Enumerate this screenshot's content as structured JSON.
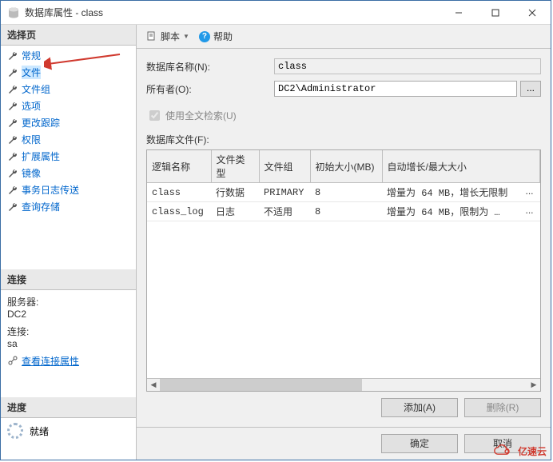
{
  "window": {
    "title": "数据库属性 - class"
  },
  "sidebar": {
    "select_page_header": "选择页",
    "items": [
      {
        "label": "常规"
      },
      {
        "label": "文件"
      },
      {
        "label": "文件组"
      },
      {
        "label": "选项"
      },
      {
        "label": "更改跟踪"
      },
      {
        "label": "权限"
      },
      {
        "label": "扩展属性"
      },
      {
        "label": "镜像"
      },
      {
        "label": "事务日志传送"
      },
      {
        "label": "查询存储"
      }
    ],
    "connection_header": "连接",
    "server_label": "服务器:",
    "server_value": "DC2",
    "conn_label": "连接:",
    "conn_value": "sa",
    "view_props_link": "查看连接属性",
    "progress_header": "进度",
    "ready_label": "就绪"
  },
  "toolbar": {
    "script_label": "脚本",
    "help_label": "帮助"
  },
  "form": {
    "db_name_label": "数据库名称(N):",
    "db_name_value": "class",
    "owner_label": "所有者(O):",
    "owner_value": "DC2\\Administrator",
    "browse_label": "...",
    "fulltext_label": "使用全文检索(U)",
    "files_label": "数据库文件(F):"
  },
  "grid": {
    "headers": {
      "logical_name": "逻辑名称",
      "file_type": "文件类型",
      "filegroup": "文件组",
      "initial_size": "初始大小(MB)",
      "autogrowth": "自动增长/最大大小"
    },
    "rows": [
      {
        "logical_name": "class",
        "file_type": "行数据",
        "filegroup": "PRIMARY",
        "initial_size": "8",
        "autogrowth": "增量为 64 MB，增长无限制",
        "browse": "..."
      },
      {
        "logical_name": "class_log",
        "file_type": "日志",
        "filegroup": "不适用",
        "initial_size": "8",
        "autogrowth": "增量为 64 MB，限制为 …",
        "browse": "..."
      }
    ]
  },
  "actions": {
    "add_label": "添加(A)",
    "remove_label": "删除(R)"
  },
  "footer": {
    "ok_label": "确定",
    "cancel_label": "取消"
  },
  "watermark": {
    "text": "亿速云"
  }
}
